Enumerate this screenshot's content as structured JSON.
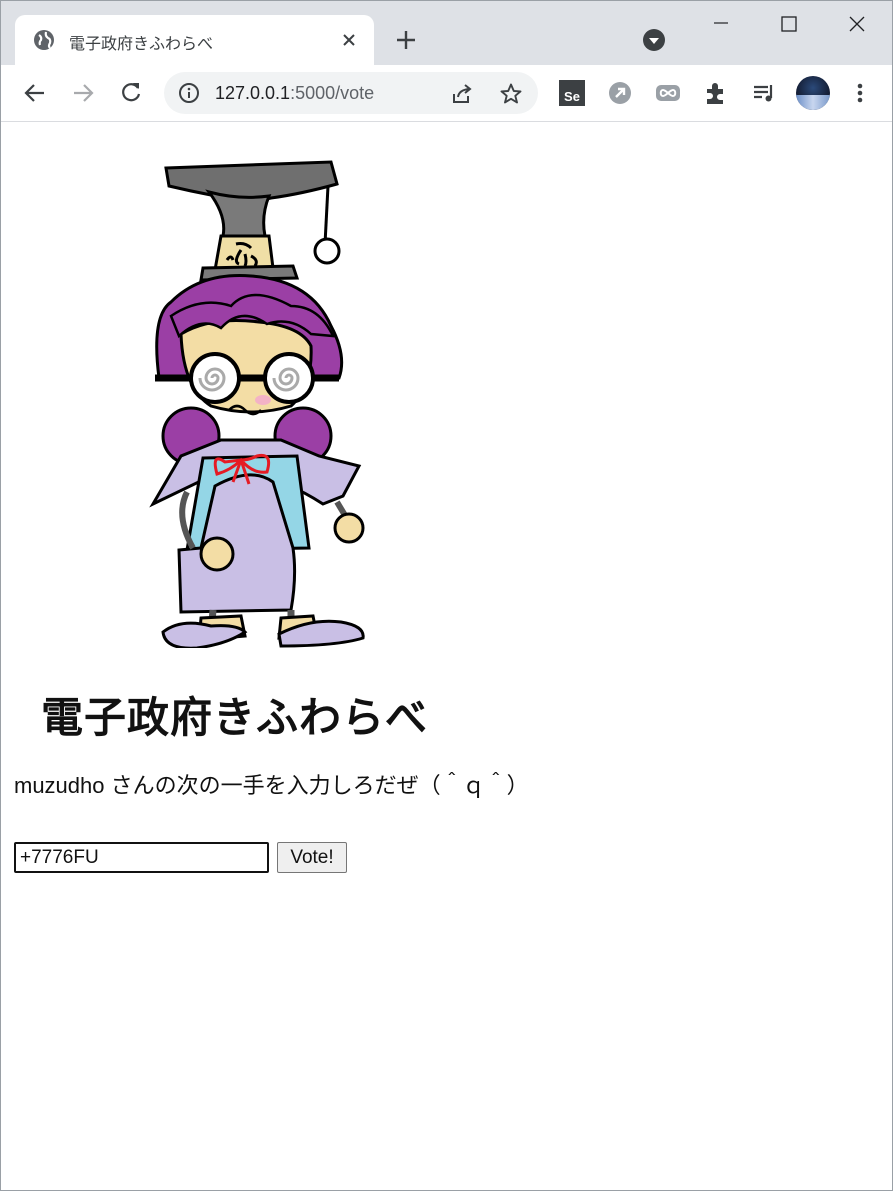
{
  "browser": {
    "tab_title": "電子政府きふわらべ",
    "url_host": "127.0.0.1",
    "url_rest": ":5000/vote",
    "extensions": [
      "selenium-ide-icon",
      "circle-arrow-icon",
      "infinity-icon",
      "puzzle-icon",
      "media-queue-icon"
    ],
    "extension_se_label": "Se"
  },
  "page": {
    "logo_text": "電子政府きふわらべ",
    "prompt": "muzudho さんの次の一手を入力しろだぜ（＾ｑ＾）",
    "move_value": "+7776FU",
    "vote_label": "Vote!"
  }
}
